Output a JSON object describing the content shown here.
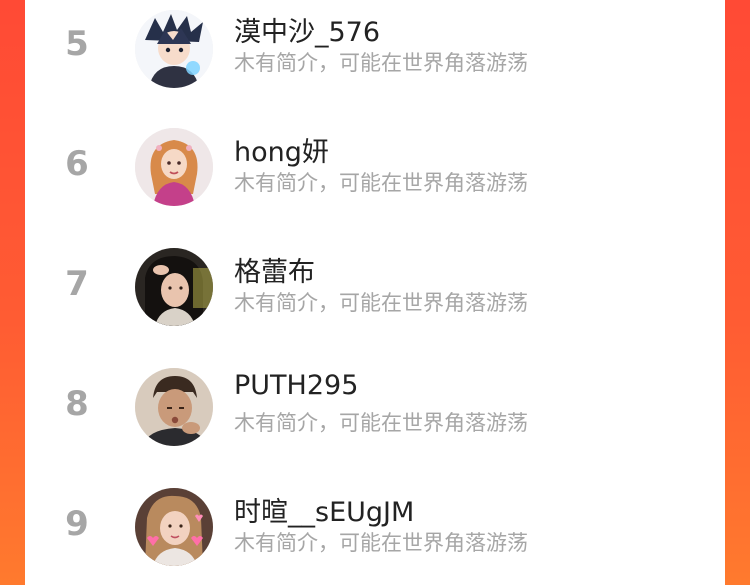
{
  "leaderboard": {
    "rows": [
      {
        "rank": "5",
        "name": "漠中沙_576",
        "bio": "木有简介，可能在世界角落游荡",
        "avatar_icon": "anime-boy-avatar-icon"
      },
      {
        "rank": "6",
        "name": "hong妍",
        "bio": "木有简介，可能在世界角落游荡",
        "avatar_icon": "illustrated-girl-avatar-icon"
      },
      {
        "rank": "7",
        "name": "格蕾布",
        "bio": "木有简介，可能在世界角落游荡",
        "avatar_icon": "woman-photo-avatar-icon"
      },
      {
        "rank": "8",
        "name": "PUTH295",
        "bio": "木有简介，可能在世界角落游荡",
        "avatar_icon": "man-photo-avatar-icon"
      },
      {
        "rank": "9",
        "name": "时暄__sEUgJM",
        "bio": "木有简介，可能在世界角落游荡",
        "avatar_icon": "girl-hearts-avatar-icon"
      }
    ]
  },
  "colors": {
    "side_gradient_top": "#ff4a35",
    "side_gradient_bottom": "#ff7a2e",
    "rank_gray": "#a6a6a6",
    "name_dark": "#222222",
    "bio_gray": "#a6a6a6"
  }
}
